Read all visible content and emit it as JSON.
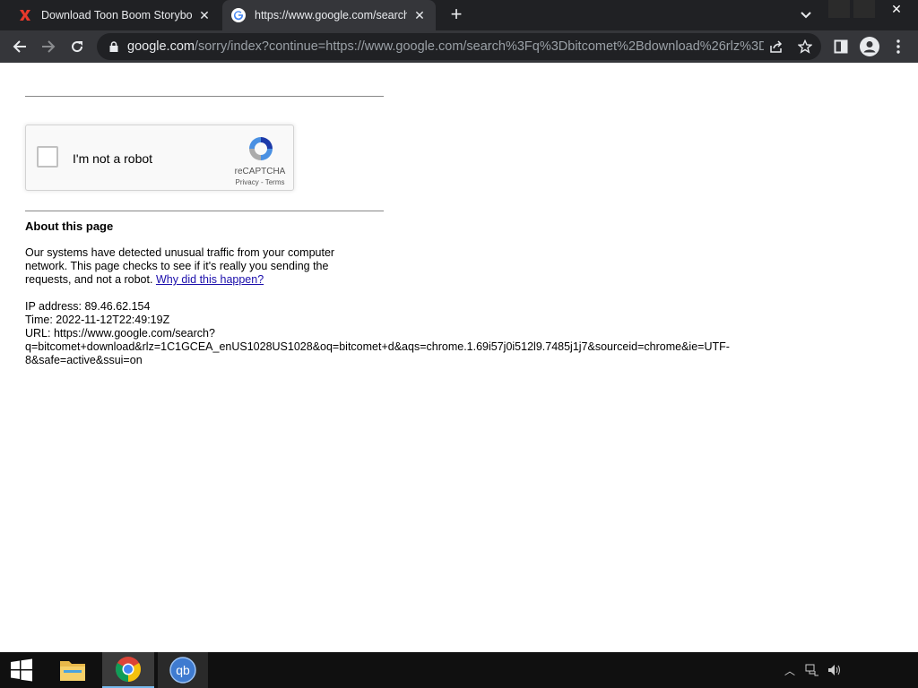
{
  "browser": {
    "tabs": [
      {
        "title": "Download Toon Boom Storyboard",
        "favicon": "red-x-icon"
      },
      {
        "title": "https://www.google.com/search?",
        "favicon": "google-g-icon"
      }
    ],
    "url_host": "google.com",
    "url_path": "/sorry/index?continue=https://www.google.com/search%3Fq%3Dbitcomet%2Bdownload%26rlz%3D..."
  },
  "recaptcha": {
    "label": "I'm not a robot",
    "brand": "reCAPTCHA",
    "links": "Privacy - Terms"
  },
  "about": {
    "heading": "About this page",
    "text": "Our systems have detected unusual traffic from your computer network. This page checks to see if it's really you sending the requests, and not a robot. ",
    "link": "Why did this happen?"
  },
  "info": {
    "ip": "IP address: 89.46.62.154",
    "time": "Time: 2022-11-12T22:49:19Z",
    "url_line1": "URL: https://www.google.com/search?",
    "url_line2": "q=bitcomet+download&rlz=1C1GCEA_enUS1028US1028&oq=bitcomet+d&aqs=chrome.1.69i57j0i512l9.7485j1j7&sourceid=chrome&ie=UTF-",
    "url_line3": "8&safe=active&ssui=on"
  },
  "colors": {
    "tabbar": "#202124",
    "toolbar": "#35363a",
    "link": "#1a0dab"
  }
}
